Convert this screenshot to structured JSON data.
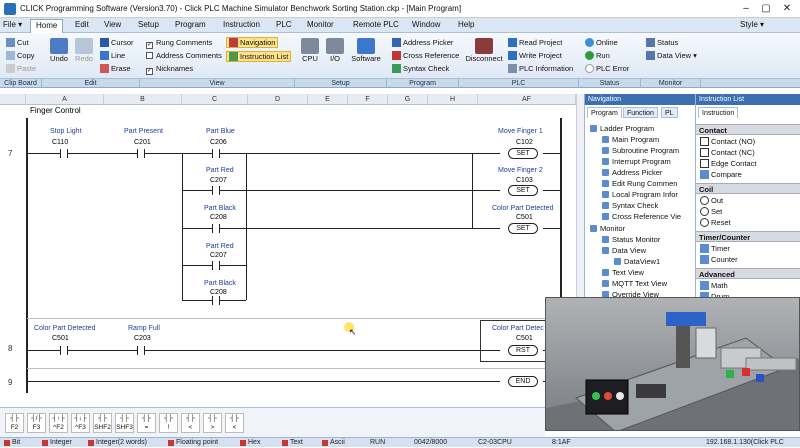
{
  "window": {
    "title": "CLICK Programming Software (Version3.70) - Click PLC Machine Simulator Benchwork Sorting Station.ckp - [Main Program]",
    "style_label": "Style ▾"
  },
  "menu": [
    "File ▾",
    "Home",
    "Edit",
    "View",
    "Setup",
    "Program",
    "Instruction",
    "PLC",
    "Monitor",
    "Remote PLC",
    "Window",
    "Help"
  ],
  "ribbon": {
    "clipboard": [
      "Cut",
      "Copy",
      "Paste"
    ],
    "edit": [
      "Undo",
      "Redo",
      "Cursor",
      "Line",
      "Erase"
    ],
    "view_checks": [
      {
        "label": "Rung Comments",
        "checked": true
      },
      {
        "label": "Address Comments",
        "checked": false
      },
      {
        "label": "Nicknames",
        "checked": true
      }
    ],
    "view_buttons": [
      "Navigation",
      "Instruction List"
    ],
    "setup": [
      "CPU",
      "I/O",
      "Software"
    ],
    "program": [
      "Address Picker",
      "Cross Reference",
      "Syntax Check"
    ],
    "plc": [
      "Disconnect",
      "Read Project",
      "Write Project",
      "PLC Information"
    ],
    "status_btns": [
      "Online",
      "Run",
      "PLC Error"
    ],
    "monitor": [
      "Status",
      "Data View ▾"
    ]
  },
  "groups": [
    "Clip Board",
    "Edit",
    "View",
    "Setup",
    "Program",
    "PLC",
    "Status",
    "Monitor"
  ],
  "ladder": {
    "header": "Finger Control",
    "columns": [
      "A",
      "B",
      "C",
      "D",
      "E",
      "F",
      "G",
      "H",
      "AF"
    ],
    "rungs": [
      "7",
      "8",
      "9"
    ],
    "contacts": [
      {
        "label": "Stop Light",
        "addr": "C110"
      },
      {
        "label": "Part Present",
        "addr": "C201"
      },
      {
        "label": "Part Blue",
        "addr": "C206"
      },
      {
        "label": "Part Red",
        "addr": "C207"
      },
      {
        "label": "Part Black",
        "addr": "C208"
      },
      {
        "label": "Part Red",
        "addr": "C207"
      },
      {
        "label": "Part Black",
        "addr": "C208"
      },
      {
        "label": "Color Part Detected",
        "addr": "C501"
      },
      {
        "label": "Ramp Full",
        "addr": "C203"
      }
    ],
    "coils": [
      {
        "label": "Move Finger 1",
        "addr": "C102",
        "type": "SET"
      },
      {
        "label": "Move Finger 2",
        "addr": "C103",
        "type": "SET"
      },
      {
        "label": "Color Part Detected",
        "addr": "C501",
        "type": "SET"
      },
      {
        "label": "Color Part Detec",
        "addr": "C501",
        "type": "RST"
      },
      {
        "label": "",
        "addr": "",
        "type": "END"
      }
    ]
  },
  "navigation": {
    "title": "Navigation",
    "tabs": [
      "Program",
      "Function",
      "PL"
    ],
    "items": [
      "Ladder Program",
      "Main Program",
      "Subroutine Program",
      "Interrupt Program",
      "Address Picker",
      "Edit Rung Commen",
      "Local Program Infor",
      "Syntax Check",
      "Cross Reference Vie",
      "Monitor",
      "Status Monitor",
      "Data View",
      "DataView1",
      "Text View",
      "MQTT Text View",
      "Override View"
    ]
  },
  "instruction_list": {
    "title": "Instruction List",
    "tab": "Instruction",
    "sections": [
      {
        "name": "Contact",
        "items": [
          "Contact (NO)",
          "Contact (NC)",
          "Edge Contact",
          "Compare"
        ]
      },
      {
        "name": "Coil",
        "items": [
          "Out",
          "Set",
          "Reset"
        ]
      },
      {
        "name": "Timer/Counter",
        "items": [
          "Timer",
          "Counter"
        ]
      },
      {
        "name": "Advanced",
        "items": [
          "Math",
          "Drum"
        ]
      }
    ]
  },
  "fkeys": [
    "F2",
    "F3",
    "^F2",
    "^F3",
    "SHF2",
    "SHF3",
    "=",
    "!",
    "<",
    ">",
    "<"
  ],
  "status": [
    "Bit",
    "Integer",
    "Integer(2 words)",
    "Floating point",
    "Hex",
    "Text",
    "Ascii",
    "RUN",
    "0042/8000",
    "C2-03CPU",
    "8:1AF",
    "192.168.1.130(Click PLC"
  ]
}
